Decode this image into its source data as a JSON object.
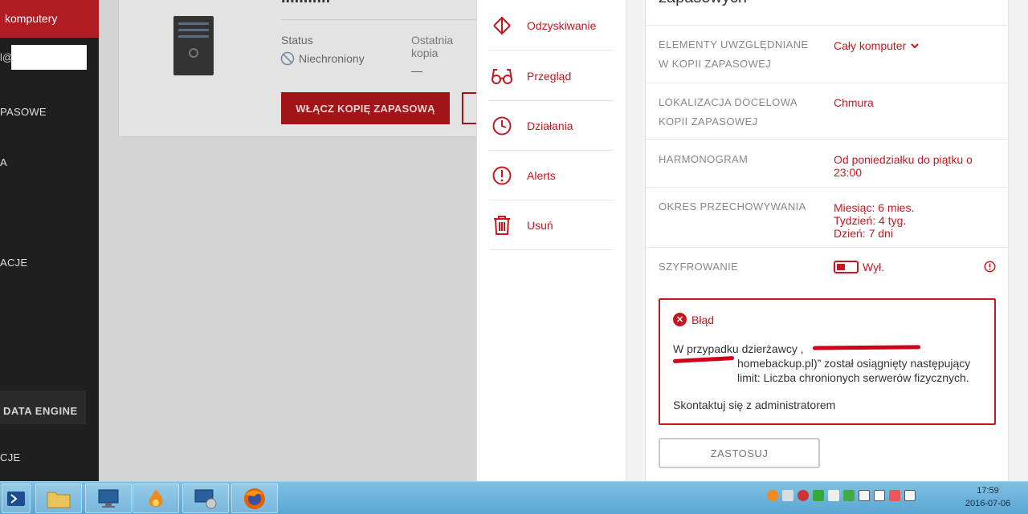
{
  "sidebar": {
    "active_item": "komputery",
    "account_fragment": "l@",
    "items": [
      {
        "label": "PASOWE"
      },
      {
        "label": "A"
      },
      {
        "label": "ACJE"
      },
      {
        "label": "CJE"
      }
    ],
    "engine_label": "DATA ENGINE"
  },
  "machine_card": {
    "title_fragment": "...........",
    "status_label": "Status",
    "status_value": "Niechroniony",
    "last_backup_label": "Ostatnia kopia zapasowa",
    "last_backup_value": "—",
    "enable_button": "WŁĄCZ KOPIĘ ZAPASOWĄ"
  },
  "menu": {
    "items": [
      {
        "label": "Odzyskiwanie",
        "icon": "recovery-icon"
      },
      {
        "label": "Przegląd",
        "icon": "glasses-icon"
      },
      {
        "label": "Działania",
        "icon": "clock-icon"
      },
      {
        "label": "Alerts",
        "icon": "alert-icon"
      },
      {
        "label": "Usuń",
        "icon": "trash-icon"
      }
    ]
  },
  "details": {
    "title_fragment": "zapasowych",
    "rows": {
      "elements": {
        "label": "ELEMENTY UWZGLĘDNIANE W KOPII ZAPASOWEJ",
        "value": "Cały komputer"
      },
      "location": {
        "label": "LOKALIZACJA DOCELOWA KOPII ZAPASOWEJ",
        "value": "Chmura"
      },
      "schedule": {
        "label": "HARMONOGRAM",
        "value": "Od poniedziałku do piątku o 23:00"
      },
      "retention": {
        "label": "OKRES PRZECHOWYWANIA",
        "value_lines": [
          "Miesiąc: 6 mies.",
          "Tydzień: 4 tyg.",
          "Dzień: 7 dni"
        ]
      },
      "encryption": {
        "label": "SZYFROWANIE",
        "value": "Wył."
      }
    },
    "error": {
      "title": "Błąd",
      "text_line1": "W przypadku dzierżawcy ,",
      "text_line2": "homebackup.pl)” został osiągnięty następujący limit: Liczba chronionych serwerów fizycznych.",
      "contact": "Skontaktuj się z administratorem"
    },
    "apply_button": "ZASTOSUJ"
  },
  "taskbar": {
    "time": "17:59",
    "date": "2016-07-06"
  },
  "colors": {
    "accent": "#c8161e",
    "sidebar_bg": "#1f1f1f",
    "active_bg": "#b01c22"
  }
}
